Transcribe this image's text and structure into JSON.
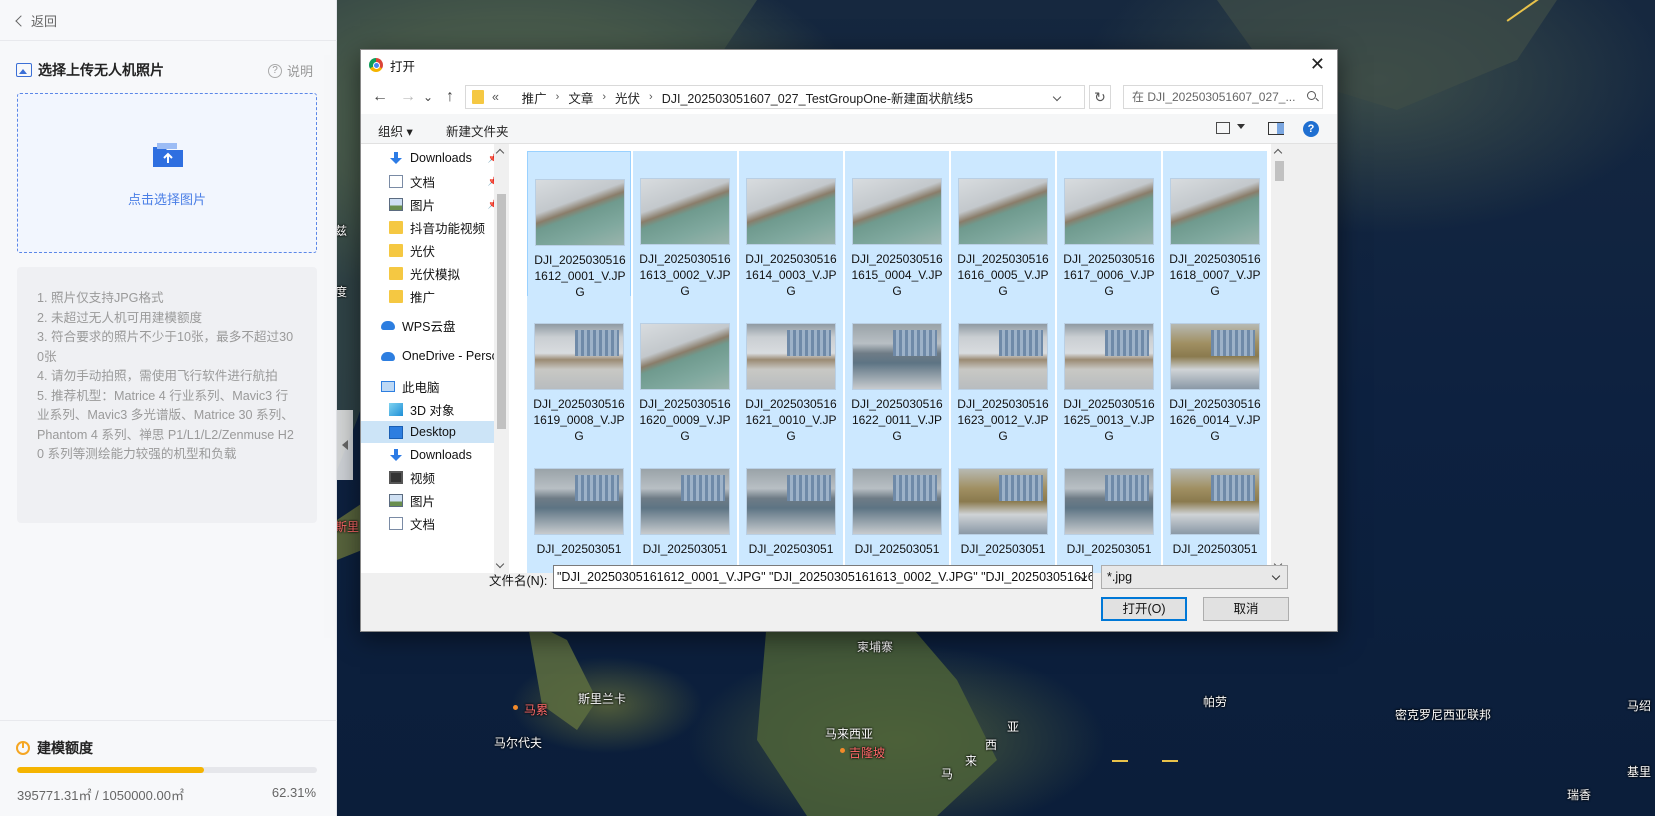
{
  "left_panel": {
    "back_label": "返回",
    "section_title": "选择上传无人机照片",
    "help_label": "说明",
    "upload_label": "点击选择图片",
    "notes": [
      "1. 照片仅支持JPG格式",
      "2. 未超过无人机可用建模额度",
      "3. 符合要求的照片不少于10张，最多不超过300张",
      "4. 请勿手动拍照，需使用飞行软件进行航拍",
      "5. 推荐机型：Matrice 4 行业系列、Mavic3 行业系列、Mavic3 多光谱版、Matrice 30 系列、Phantom 4 系列、禅思 P1/L1/L2/Zenmuse H20 系列等测绘能力较强的机型和负载"
    ],
    "quota_title": "建模额度",
    "quota_used": "395771.31㎡ / 1050000.00㎡",
    "quota_percent": "62.31%",
    "quota_fraction": 0.6231,
    "accent_color": "#4a7ee6",
    "quota_color": "#f5b400"
  },
  "map": {
    "labels": {
      "dongpuzhai": "柬埔寨",
      "sililanka": "斯里兰卡",
      "male": "马累",
      "maldives": "马尔代夫",
      "malaysia": "马来西亚",
      "kualalumpur": "吉隆坡",
      "palau": "帕劳",
      "micronesia": "密克罗尼西亚联邦",
      "ma": "马",
      "lai": "来",
      "xi": "西",
      "ya": "亚",
      "majuro": "马绍",
      "kiribati": "基里",
      "ruibei": "瑞香",
      "frag1": "兹",
      "frag2": "度",
      "frag3": "斯里"
    }
  },
  "dialog": {
    "title": "打开",
    "close": "✕",
    "nav": {
      "back": "←",
      "forward": "→",
      "dropdown": "⌄",
      "up": "↑"
    },
    "breadcrumb": [
      "«",
      "推广",
      "文章",
      "光伏",
      "DJI_202503051607_027_TestGroupOne-新建面状航线5"
    ],
    "breadcrumb_sep": "›",
    "refresh": "↻",
    "search_placeholder": "在 DJI_202503051607_027_...",
    "toolbar": {
      "organize": "组织 ▾",
      "new_folder": "新建文件夹",
      "help": "?"
    },
    "tree": [
      {
        "label": "Downloads",
        "icon": "download-icon",
        "pinned": true
      },
      {
        "label": "文档",
        "icon": "document-icon",
        "pinned": true
      },
      {
        "label": "图片",
        "icon": "pictures-icon",
        "pinned": true
      },
      {
        "label": "抖音功能视频",
        "icon": "folder-icon"
      },
      {
        "label": "光伏",
        "icon": "folder-icon"
      },
      {
        "label": "光伏模拟",
        "icon": "folder-icon"
      },
      {
        "label": "推广",
        "icon": "folder-icon"
      },
      {
        "label": "WPS云盘",
        "icon": "cloud-icon"
      },
      {
        "label": "OneDrive - Persc",
        "icon": "onedrive-icon"
      },
      {
        "label": "此电脑",
        "icon": "computer-icon"
      },
      {
        "label": "3D 对象",
        "icon": "cube-icon"
      },
      {
        "label": "Desktop",
        "icon": "desktop-icon",
        "selected": true
      },
      {
        "label": "Downloads",
        "icon": "download-icon"
      },
      {
        "label": "视频",
        "icon": "video-icon"
      },
      {
        "label": "图片",
        "icon": "pictures-icon"
      },
      {
        "label": "文档",
        "icon": "document-icon"
      }
    ],
    "pin_glyph": "📌",
    "files": [
      "DJI_20250305161612_0001_V.JPG",
      "DJI_20250305161613_0002_V.JPG",
      "DJI_20250305161614_0003_V.JPG",
      "DJI_20250305161615_0004_V.JPG",
      "DJI_20250305161616_0005_V.JPG",
      "DJI_20250305161617_0006_V.JPG",
      "DJI_20250305161618_0007_V.JPG",
      "DJI_20250305161619_0008_V.JPG",
      "DJI_20250305161620_0009_V.JPG",
      "DJI_20250305161621_0010_V.JPG",
      "DJI_20250305161622_0011_V.JPG",
      "DJI_20250305161623_0012_V.JPG",
      "DJI_20250305161625_0013_V.JPG",
      "DJI_20250305161626_0014_V.JPG",
      "DJI_202503051",
      "DJI_202503051",
      "DJI_202503051",
      "DJI_202503051",
      "DJI_202503051",
      "DJI_202503051",
      "DJI_202503051"
    ],
    "filename_label": "文件名(N):",
    "filename_value": "\"DJI_20250305161612_0001_V.JPG\" \"DJI_20250305161613_0002_V.JPG\" \"DJI_20250305161614_0",
    "filetype_value": "*.jpg",
    "open_button": "打开(O)",
    "cancel_button": "取消"
  }
}
